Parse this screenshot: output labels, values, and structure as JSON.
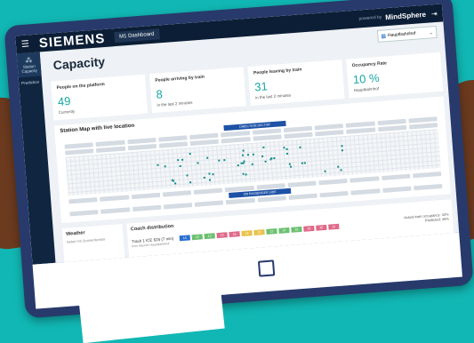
{
  "app": {
    "brand": "SIEMENS",
    "dashboard_tab": "M1 Dashboard",
    "powered_by": "powered by",
    "platform": "MindSphere"
  },
  "sidebar": {
    "items": [
      {
        "label": "Station Capacity",
        "icon": "crowd-icon"
      },
      {
        "label": "Prediction",
        "icon": "prediction-icon"
      }
    ]
  },
  "header": {
    "title": "Capacity",
    "station_select": "Hauptbahnhof"
  },
  "kpis": [
    {
      "label": "People on the platform",
      "value": "49",
      "sub": "Currently"
    },
    {
      "label": "People arriving by train",
      "value": "8",
      "sub": "in the last 2 minutes"
    },
    {
      "label": "People leaving by train",
      "value": "31",
      "sub": "in the last 2 minutes"
    },
    {
      "label": "Occupancy Rate",
      "value": "10 %",
      "sub": "Hauptbahnhof"
    }
  ],
  "map": {
    "title": "Station Map with live location",
    "direction_top": "DIRECTION SECTOR",
    "direction_bottom": "ON PASSENGER SIDE"
  },
  "weather": {
    "title": "Weather",
    "text": "Nebel mit Sonnenfenster"
  },
  "coach": {
    "title": "Coach distribution",
    "train": "Track 1 ICE 625 (7 min)",
    "sub": "from Munich Hauptbahnhof",
    "cars": [
      {
        "label": "1A",
        "color": "#2a6fd0"
      },
      {
        "label": "10",
        "color": "#6cc070"
      },
      {
        "label": "12",
        "color": "#6cc070"
      },
      {
        "label": "14",
        "color": "#e06a8a"
      },
      {
        "label": "16",
        "color": "#e06a8a"
      },
      {
        "label": "18",
        "color": "#e8c24a"
      },
      {
        "label": "20",
        "color": "#e8c24a"
      },
      {
        "label": "22",
        "color": "#6cc070"
      },
      {
        "label": "24",
        "color": "#6cc070"
      },
      {
        "label": "26",
        "color": "#6cc070"
      },
      {
        "label": "28",
        "color": "#e06a8a"
      },
      {
        "label": "30",
        "color": "#e06a8a"
      },
      {
        "label": "32",
        "color": "#e06a8a"
      }
    ],
    "right_line1": "Actual train occupancy: 42%",
    "right_line2": "Predicted: 46%"
  },
  "colors": {
    "background": "#11b7b4",
    "accent": "#19a6a3",
    "tablet": "#283a6b"
  }
}
